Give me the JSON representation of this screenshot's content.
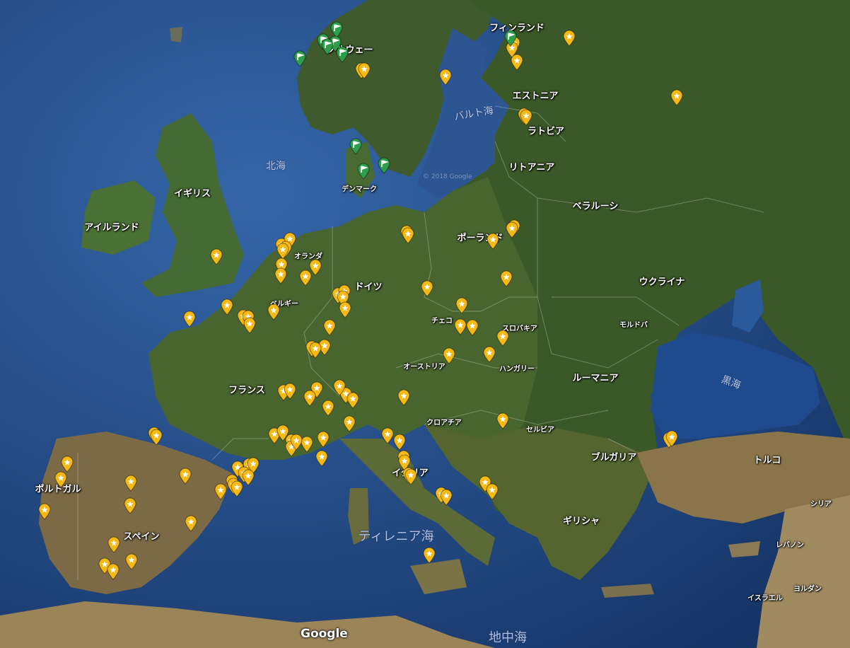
{
  "map": {
    "attribution": "Google",
    "watermark": "© 2018 Google",
    "colors": {
      "sea": "#1b3f78",
      "land": "#3c5a2a",
      "pin_yellow": "#f5b915",
      "pin_green": "#2f9e4a"
    }
  },
  "labels": [
    {
      "text": "フィンランド",
      "kind": "country"
    },
    {
      "text": "ノルウェー",
      "kind": "country"
    },
    {
      "text": "エストニア",
      "kind": "country"
    },
    {
      "text": "バルト海",
      "kind": "sea"
    },
    {
      "text": "ラトビア",
      "kind": "country"
    },
    {
      "text": "北海",
      "kind": "sea"
    },
    {
      "text": "リトアニア",
      "kind": "country"
    },
    {
      "text": "デンマーク",
      "kind": "country_small"
    },
    {
      "text": "イギリス",
      "kind": "country"
    },
    {
      "text": "ベラルーシ",
      "kind": "country"
    },
    {
      "text": "アイルランド",
      "kind": "country"
    },
    {
      "text": "ポーランド",
      "kind": "country"
    },
    {
      "text": "オランダ",
      "kind": "country_small"
    },
    {
      "text": "ウクライナ",
      "kind": "country"
    },
    {
      "text": "ドイツ",
      "kind": "country"
    },
    {
      "text": "ベルギー",
      "kind": "country_small"
    },
    {
      "text": "チェコ",
      "kind": "country_small"
    },
    {
      "text": "モルドバ",
      "kind": "country_small"
    },
    {
      "text": "スロバキア",
      "kind": "country_small"
    },
    {
      "text": "黒海",
      "kind": "sea"
    },
    {
      "text": "オーストリア",
      "kind": "country_small"
    },
    {
      "text": "ハンガリー",
      "kind": "country_small"
    },
    {
      "text": "ルーマニア",
      "kind": "country"
    },
    {
      "text": "フランス",
      "kind": "country"
    },
    {
      "text": "クロアチア",
      "kind": "country_small"
    },
    {
      "text": "セルビア",
      "kind": "country_small"
    },
    {
      "text": "ブルガリア",
      "kind": "country"
    },
    {
      "text": "トルコ",
      "kind": "country"
    },
    {
      "text": "ポルトガル",
      "kind": "country"
    },
    {
      "text": "イタリア",
      "kind": "country"
    },
    {
      "text": "シリア",
      "kind": "country_small"
    },
    {
      "text": "ギリシャ",
      "kind": "country"
    },
    {
      "text": "スペイン",
      "kind": "country"
    },
    {
      "text": "ティレニア海",
      "kind": "sea_big"
    },
    {
      "text": "レバノン",
      "kind": "country_small"
    },
    {
      "text": "ヨルダン",
      "kind": "country_small"
    },
    {
      "text": "イスラエル",
      "kind": "country_small"
    },
    {
      "text": "地中海",
      "kind": "sea_big"
    }
  ],
  "pins": {
    "yellow_count": 118,
    "green_count": 10
  }
}
